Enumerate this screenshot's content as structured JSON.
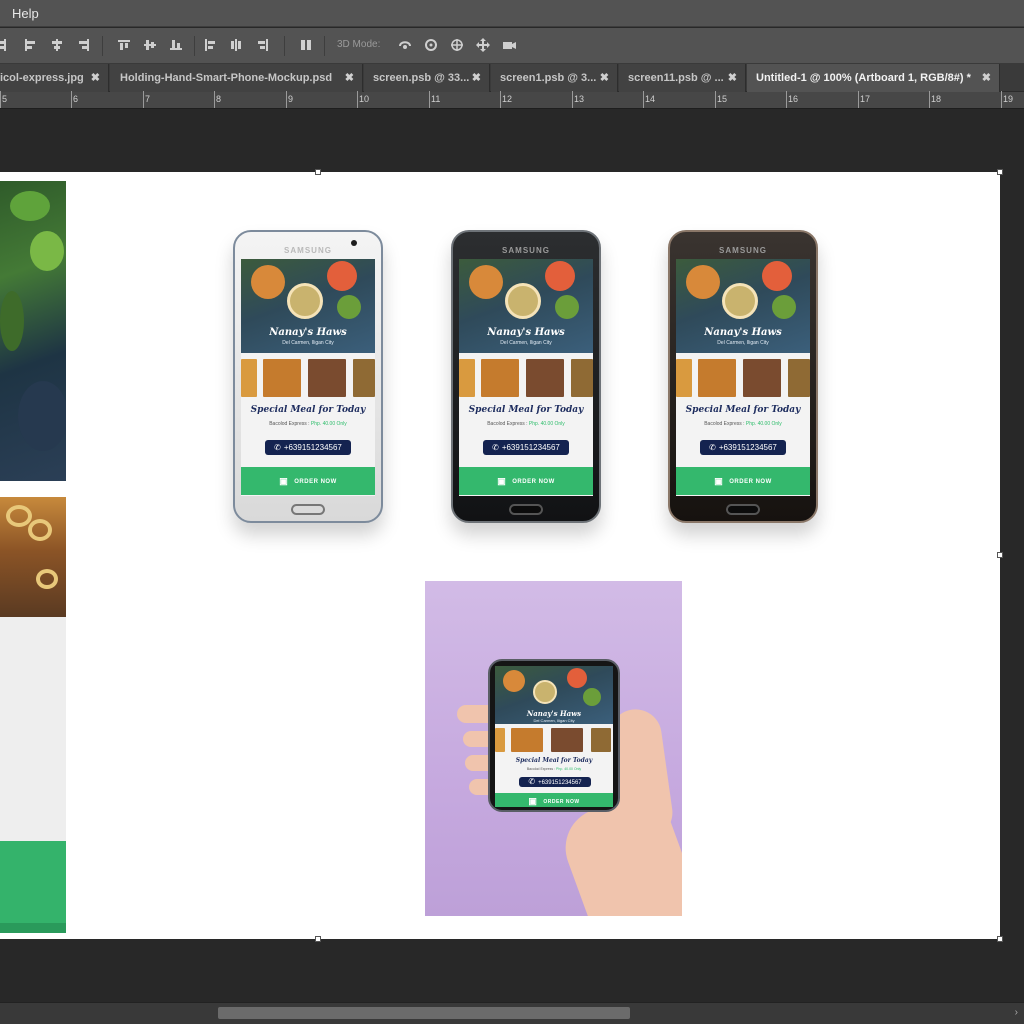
{
  "menu": {
    "items": [
      "Help"
    ]
  },
  "options_bar": {
    "mode_label": "3D Mode:"
  },
  "tabs": [
    {
      "label": "icol-express.jpg"
    },
    {
      "label": "Holding-Hand-Smart-Phone-Mockup.psd"
    },
    {
      "label": "screen.psb @ 33..."
    },
    {
      "label": "screen1.psb @ 3..."
    },
    {
      "label": "screen11.psb @ ..."
    },
    {
      "label": "Untitled-1 @ 100% (Artboard 1, RGB/8#) *",
      "active": true
    }
  ],
  "ruler": {
    "numbers": [
      "5",
      "6",
      "7",
      "8",
      "9",
      "10",
      "11",
      "12",
      "13",
      "14",
      "15",
      "16",
      "17",
      "18",
      "19"
    ]
  },
  "phone_brand": "SAMSUNG",
  "app_screen": {
    "title": "Nanay's Haws",
    "subtitle": "Del Carmen, Iligan City",
    "special": "Special Meal for Today",
    "item": "Bacolod Express :",
    "price": "Php. 40.00 Only",
    "phone_number": "+639151234567",
    "order": "ORDER NOW"
  },
  "colors": {
    "accent_green": "#34b86d",
    "navy": "#142350",
    "mockup_bg": "#c6a9df"
  },
  "icons": {
    "phone": "phone-icon",
    "cart": "cart-icon",
    "close": "close-icon"
  }
}
